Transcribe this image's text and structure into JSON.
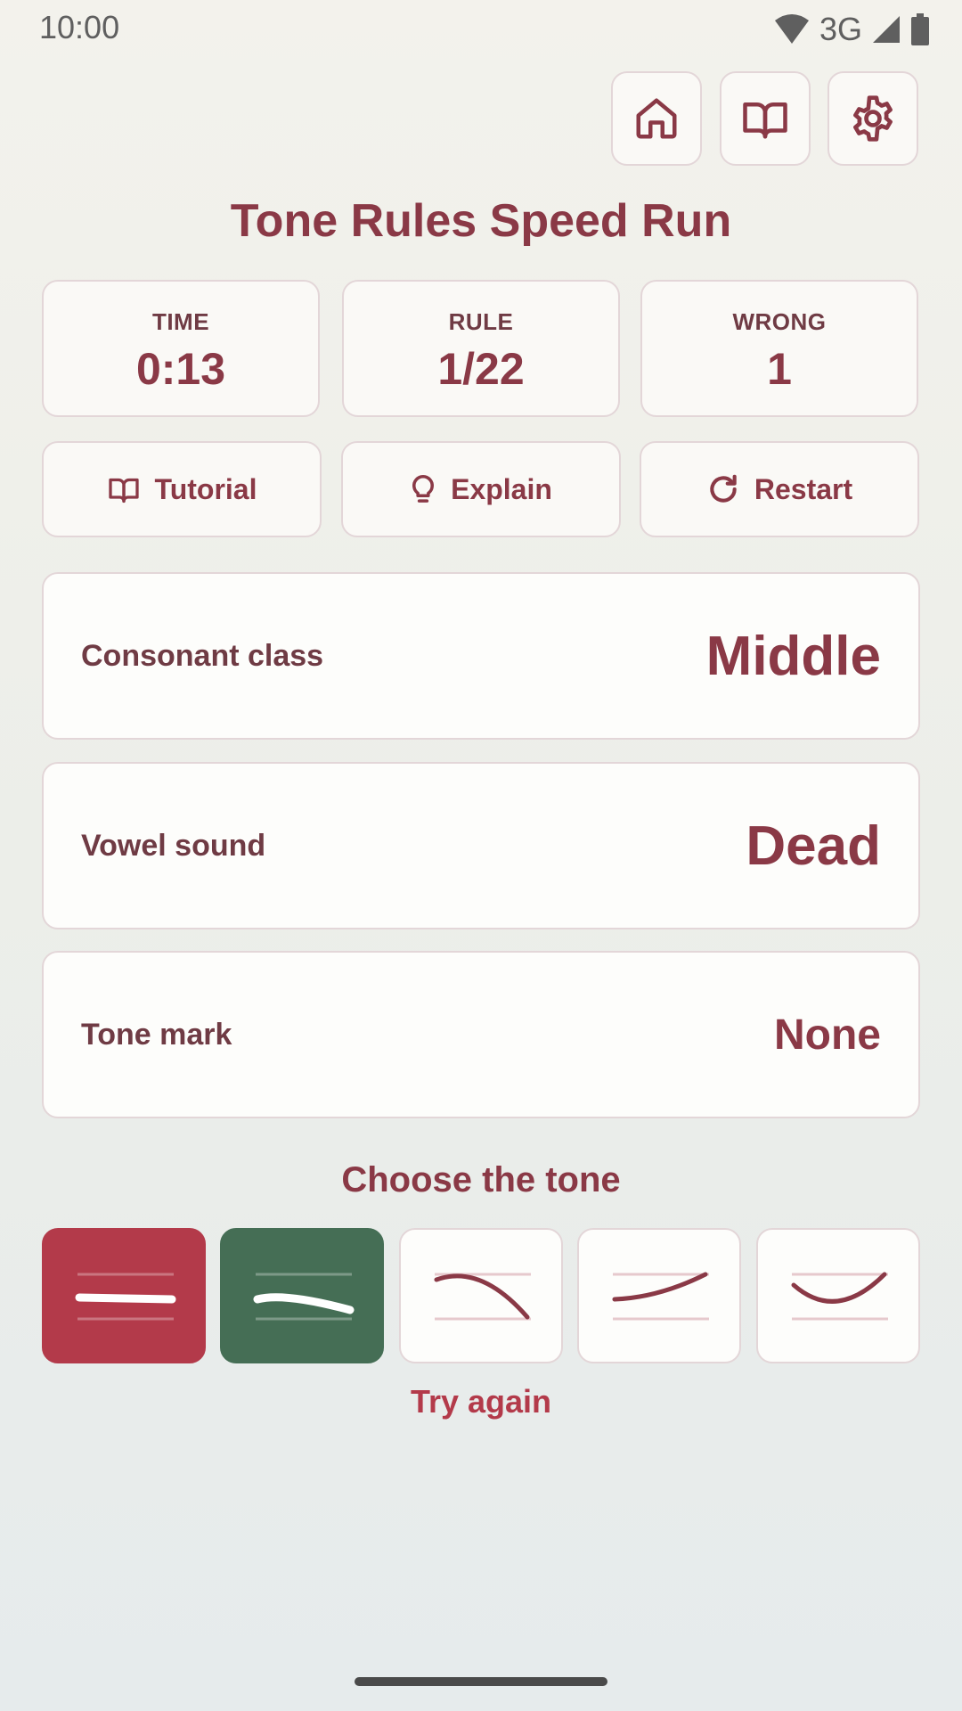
{
  "status_bar": {
    "time": "10:00",
    "network": "3G"
  },
  "title": "Tone Rules Speed Run",
  "stats": {
    "time": {
      "label": "TIME",
      "value": "0:13"
    },
    "rule": {
      "label": "RULE",
      "value": "1/22"
    },
    "wrong": {
      "label": "WRONG",
      "value": "1"
    }
  },
  "actions": {
    "tutorial": "Tutorial",
    "explain": "Explain",
    "restart": "Restart"
  },
  "rule_cards": {
    "consonant_class": {
      "label": "Consonant class",
      "value": "Middle"
    },
    "vowel_sound": {
      "label": "Vowel sound",
      "value": "Dead"
    },
    "tone_mark": {
      "label": "Tone mark",
      "value": "None"
    }
  },
  "choose_title": "Choose the tone",
  "tone_options": [
    {
      "icon": "mid-tone-contour-icon",
      "state": "wrong"
    },
    {
      "icon": "low-tone-contour-icon",
      "state": "correct"
    },
    {
      "icon": "falling-tone-contour-icon",
      "state": "default"
    },
    {
      "icon": "high-tone-contour-icon",
      "state": "default"
    },
    {
      "icon": "rising-tone-contour-icon",
      "state": "default"
    }
  ],
  "feedback": "Try again",
  "colors": {
    "accent": "#8a3946",
    "wrong": "#b33a4a",
    "correct": "#456e55",
    "card_border": "#e3d6d8"
  }
}
